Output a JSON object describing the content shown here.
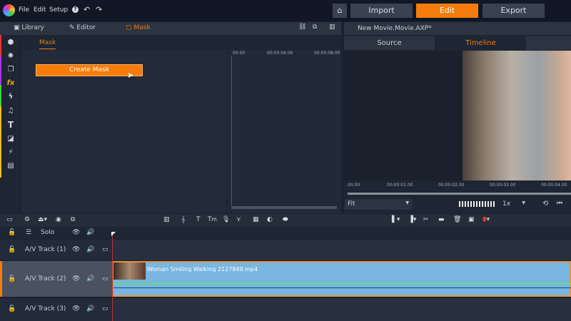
{
  "menu": {
    "items": [
      "File",
      "Edit",
      "Setup"
    ],
    "help": "?"
  },
  "nav": {
    "import": "Import",
    "edit": "Edit",
    "export": "Export"
  },
  "tabs": {
    "library": "Library",
    "editor": "Editor",
    "mask": "Mask"
  },
  "mask": {
    "header": "Mask",
    "create_button": "Create Mask"
  },
  "mini_ruler": [
    "00.00",
    "00:00:04.00",
    "00:00:08.00"
  ],
  "right": {
    "title": "New Movie.Movie.AXP*",
    "source_tab": "Source",
    "timeline_tab": "Timeline",
    "ruler": [
      "00.00",
      "00:00:01.00",
      "00:00:02.00",
      "00:00:03.00",
      "00:00:04.00"
    ],
    "fit": "Fit",
    "speed": "1x"
  },
  "tracks": {
    "solo": "Solo",
    "rows": [
      "A/V Track (1)",
      "A/V Track (2)",
      "A/V Track (3)"
    ]
  },
  "clip": {
    "name": "Woman Smiling Walking 2127849.mp4"
  },
  "colors": {
    "accent": "#f57c0a",
    "clip": "#79b6e0"
  }
}
